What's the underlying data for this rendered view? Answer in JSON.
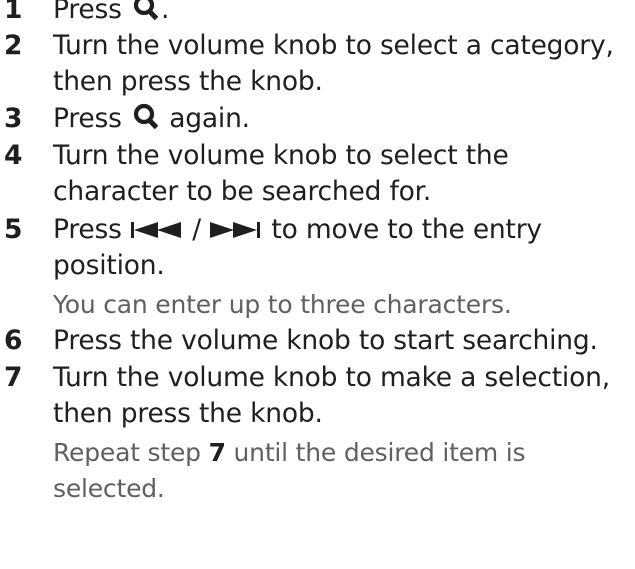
{
  "steps": [
    {
      "number": "1",
      "before_icon": "Press",
      "after_icon": "."
    },
    {
      "number": "2",
      "line1": "Turn the volume knob to select a category,",
      "line2": "then press the knob."
    },
    {
      "number": "3",
      "before_icon": "Press",
      "after_icon": "again."
    },
    {
      "number": "4",
      "line1": "Turn the volume knob to select the",
      "line2": "character to be searched for."
    },
    {
      "number": "5",
      "before_icon": "Press",
      "separator": "/",
      "after_icon": "to move to the entry",
      "line2": "position.",
      "note": "You can enter up to three characters."
    },
    {
      "number": "6",
      "line1": "Press the volume knob to start searching."
    },
    {
      "number": "7",
      "line1": "Turn the volume knob to make a selection,",
      "line2": "then press the knob.",
      "note_before": "Repeat step",
      "note_step": "7",
      "note_after": "until the desired item is",
      "note_line2": "selected."
    }
  ],
  "icons": {
    "search": "search-icon",
    "prev": "skip-previous-icon",
    "next": "skip-next-icon"
  }
}
